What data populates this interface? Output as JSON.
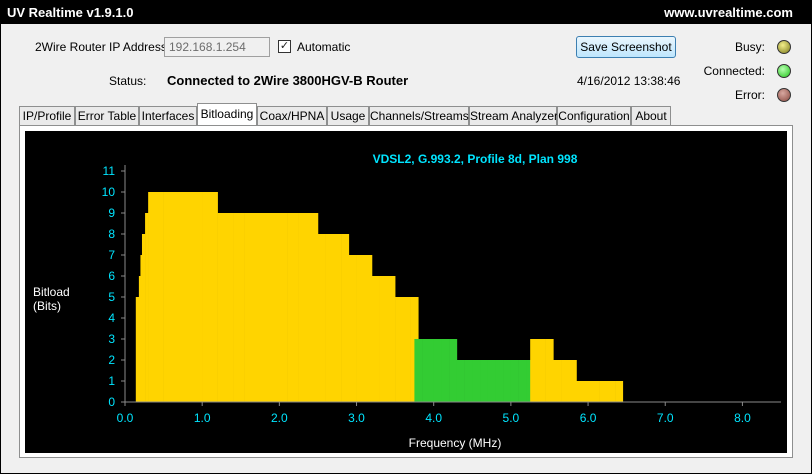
{
  "window": {
    "title": "UV Realtime v1.9.1.0",
    "url": "www.uvrealtime.com"
  },
  "controls": {
    "ip_label": "2Wire Router IP Address:",
    "ip_value": "192.168.1.254",
    "automatic_checked": true,
    "automatic_label": "Automatic",
    "status_label": "Status:",
    "status_value": "Connected to 2Wire 3800HGV-B Router",
    "timestamp": "4/16/2012 13:38:46",
    "save_label": "Save Screenshot",
    "check_mark": "✓"
  },
  "indicators": [
    {
      "label": "Busy:",
      "color": "#c2bf3a"
    },
    {
      "label": "Connected:",
      "color": "#2ee020"
    },
    {
      "label": "Error:",
      "color": "#a8665c"
    }
  ],
  "tabs": [
    "IP/Profile",
    "Error Table",
    "Interfaces",
    "Bitloading",
    "Coax/HPNA",
    "Usage",
    "Channels/Streams",
    "Stream Analyzer",
    "Configuration",
    "About"
  ],
  "active_tab": "Bitloading",
  "chart_data": {
    "type": "bar",
    "title": "VDSL2, G.993.2, Profile 8d, Plan 998",
    "xlabel": "Frequency (MHz)",
    "ylabel": "Bitload\n(Bits)",
    "xlim": [
      0,
      8.5
    ],
    "ylim": [
      0,
      11
    ],
    "x_ticks": [
      "0.0",
      "1.0",
      "2.0",
      "3.0",
      "4.0",
      "5.0",
      "6.0",
      "7.0",
      "8.0"
    ],
    "y_ticks": [
      "0",
      "1",
      "2",
      "3",
      "4",
      "5",
      "6",
      "7",
      "8",
      "9",
      "10",
      "11"
    ],
    "grid": false,
    "colors": {
      "downstream": "#ffd400",
      "upstream": "#33cc33",
      "text": "#00e5ff"
    },
    "series": [
      {
        "direction": "downstream",
        "color": "#ffd400",
        "x_mhz": [
          0.14,
          0.18,
          0.2,
          0.22,
          0.26,
          0.3,
          0.4,
          0.5,
          0.6,
          0.75,
          0.9,
          1.0,
          1.1,
          1.2,
          1.3,
          1.4,
          1.55,
          1.65,
          1.8,
          1.95,
          2.1,
          2.25,
          2.4,
          2.5,
          2.6,
          2.7,
          2.8,
          2.9,
          3.0,
          3.1,
          3.2,
          3.3,
          3.4,
          3.5,
          3.6,
          3.7
        ],
        "bits": [
          5,
          6,
          7,
          8,
          9,
          10,
          10,
          10,
          10,
          10,
          10,
          10,
          10,
          9,
          9,
          9,
          9,
          9,
          9,
          9,
          9,
          9,
          9,
          8,
          8,
          8,
          8,
          7,
          7,
          7,
          6,
          6,
          6,
          5,
          5,
          5
        ]
      },
      {
        "direction": "upstream",
        "color": "#33cc33",
        "x_mhz": [
          3.75,
          3.85,
          4.0,
          4.1,
          4.2,
          4.3,
          4.4,
          4.5,
          4.6,
          4.7,
          4.8,
          4.9,
          5.0,
          5.1,
          5.2
        ],
        "bits": [
          3,
          3,
          3,
          3,
          3,
          2,
          2,
          2,
          2,
          2,
          2,
          2,
          2,
          2,
          2
        ]
      },
      {
        "direction": "downstream",
        "color": "#ffd400",
        "x_mhz": [
          5.25,
          5.35,
          5.45,
          5.55,
          5.65,
          5.75,
          5.85,
          5.95,
          6.05,
          6.15,
          6.25,
          6.35
        ],
        "bits": [
          3,
          3,
          3,
          2,
          2,
          2,
          1,
          1,
          1,
          1,
          1,
          1
        ]
      }
    ]
  }
}
